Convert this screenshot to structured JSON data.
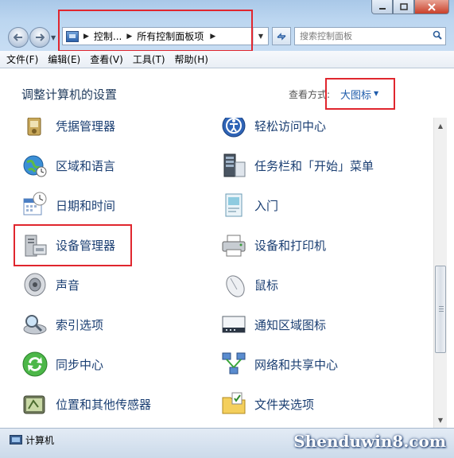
{
  "address": {
    "crumbs": [
      "控制...",
      "所有控制面板项"
    ],
    "search_placeholder": "搜索控制面板"
  },
  "menu": [
    "文件(F)",
    "编辑(E)",
    "查看(V)",
    "工具(T)",
    "帮助(H)"
  ],
  "page_title": "调整计算机的设置",
  "view_by": {
    "label": "查看方式:",
    "value": "大图标"
  },
  "items_left": [
    {
      "label": "凭据管理器",
      "icon": "credential-icon"
    },
    {
      "label": "区域和语言",
      "icon": "globe-clock-icon"
    },
    {
      "label": "日期和时间",
      "icon": "calendar-clock-icon"
    },
    {
      "label": "设备管理器",
      "icon": "device-manager-icon"
    },
    {
      "label": "声音",
      "icon": "speaker-icon"
    },
    {
      "label": "索引选项",
      "icon": "index-magnifier-icon"
    },
    {
      "label": "同步中心",
      "icon": "sync-icon"
    },
    {
      "label": "位置和其他传感器",
      "icon": "location-sensor-icon"
    }
  ],
  "items_right": [
    {
      "label": "轻松访问中心",
      "icon": "accessibility-icon"
    },
    {
      "label": "任务栏和「开始」菜单",
      "icon": "taskbar-icon"
    },
    {
      "label": "入门",
      "icon": "getting-started-icon"
    },
    {
      "label": "设备和打印机",
      "icon": "printer-icon"
    },
    {
      "label": "鼠标",
      "icon": "mouse-icon"
    },
    {
      "label": "通知区域图标",
      "icon": "notification-area-icon"
    },
    {
      "label": "网络和共享中心",
      "icon": "network-icon"
    },
    {
      "label": "文件夹选项",
      "icon": "folder-options-icon"
    }
  ],
  "status": {
    "text": "计算机"
  },
  "watermark": "Shenduwin8.com"
}
